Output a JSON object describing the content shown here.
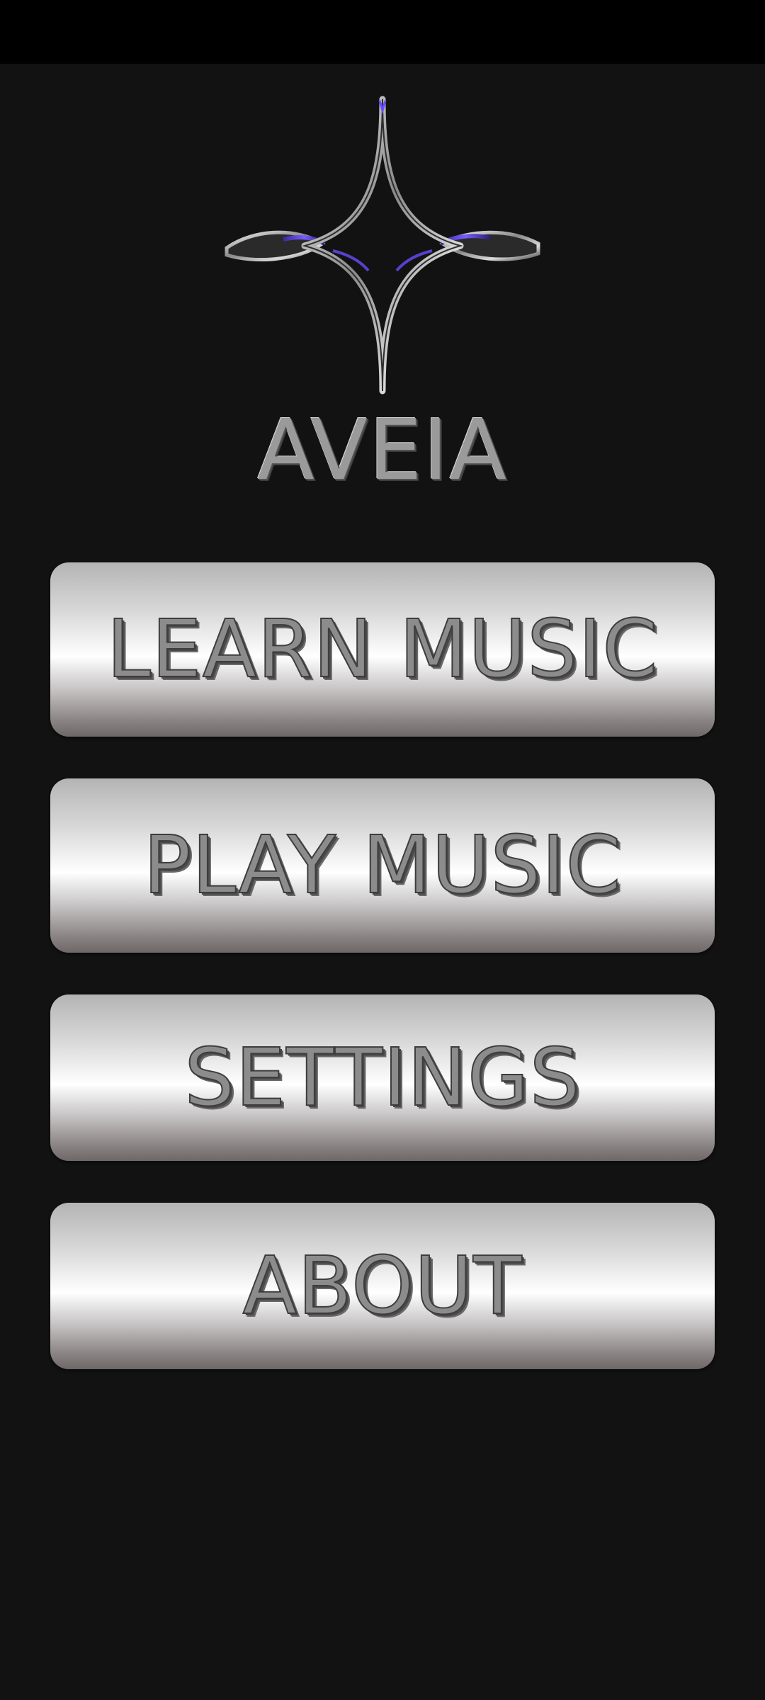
{
  "app": {
    "brand_name": "AVEIA"
  },
  "logo": {
    "icon": "four-point-star-logo-icon",
    "colors": {
      "metal_light": "#e8e8e8",
      "metal_dark": "#555555",
      "accent": "#6a4cff"
    }
  },
  "menu": {
    "items": [
      {
        "id": "learn",
        "label": "LEARN MUSIC"
      },
      {
        "id": "play",
        "label": "PLAY MUSIC"
      },
      {
        "id": "settings",
        "label": "SETTINGS"
      },
      {
        "id": "about",
        "label": "ABOUT"
      }
    ]
  },
  "theme": {
    "background": "#121212",
    "status_bar": "#000000"
  }
}
